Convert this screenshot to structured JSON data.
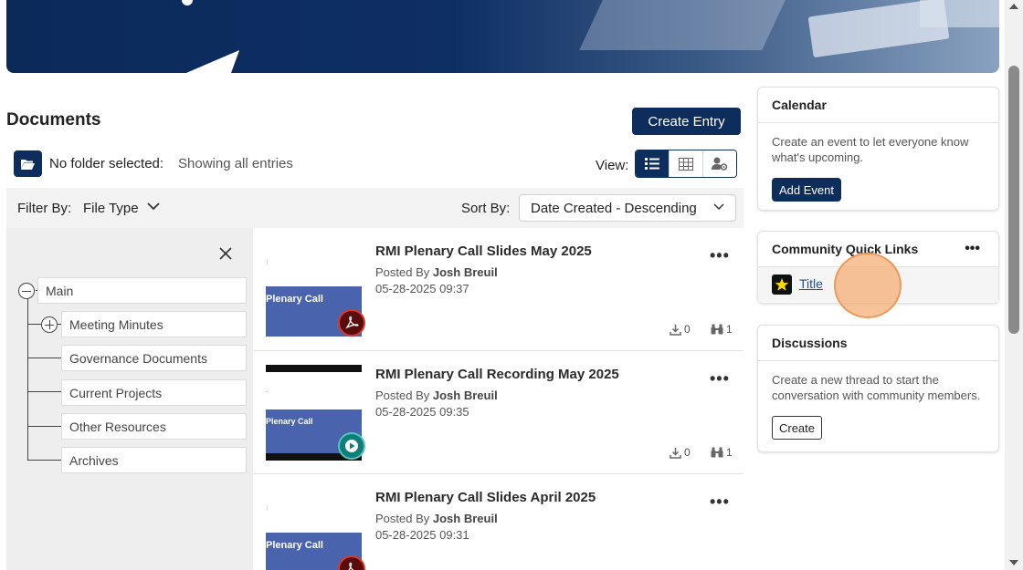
{
  "documents": {
    "title": "Documents",
    "create_entry_label": "Create Entry",
    "folder_status": "No folder selected:",
    "showing_text": "Showing all entries",
    "view_label": "View:",
    "filter_label": "Filter By:",
    "filter_value": "File Type",
    "sort_label": "Sort By:",
    "sort_value": "Date Created - Descending"
  },
  "tree": {
    "root": "Main",
    "children": [
      "Meeting Minutes",
      "Governance Documents",
      "Current Projects",
      "Other Resources",
      "Archives"
    ]
  },
  "entries": [
    {
      "title": "RMI Plenary Call Slides May 2025",
      "posted_prefix": "Posted By",
      "author": "Josh Breuil",
      "date": "05-28-2025 09:37",
      "downloads": "0",
      "views": "1",
      "type_icon": "pdf-icon",
      "thumb_text": "Plenary Call"
    },
    {
      "title": "RMI Plenary Call Recording May 2025",
      "posted_prefix": "Posted By",
      "author": "Josh Breuil",
      "date": "05-28-2025 09:35",
      "downloads": "0",
      "views": "1",
      "type_icon": "play-icon",
      "thumb_text": "Plenary Call"
    },
    {
      "title": "RMI Plenary Call Slides April 2025",
      "posted_prefix": "Posted By",
      "author": "Josh Breuil",
      "date": "05-28-2025 09:31",
      "type_icon": "pdf-icon",
      "thumb_text": "Plenary Call"
    }
  ],
  "calendar": {
    "title": "Calendar",
    "text": "Create an event to let everyone know what's upcoming.",
    "button": "Add Event"
  },
  "quick_links": {
    "title": "Community Quick Links",
    "menu": "•••",
    "link": "Title"
  },
  "discussions": {
    "title": "Discussions",
    "text": "Create a new thread to start the conversation with community members.",
    "button": "Create"
  },
  "entry_menu": "•••",
  "colors": {
    "primary": "#0d2d5c",
    "pdf_red": "#d93b2a",
    "video_teal": "#0d7f7a"
  }
}
